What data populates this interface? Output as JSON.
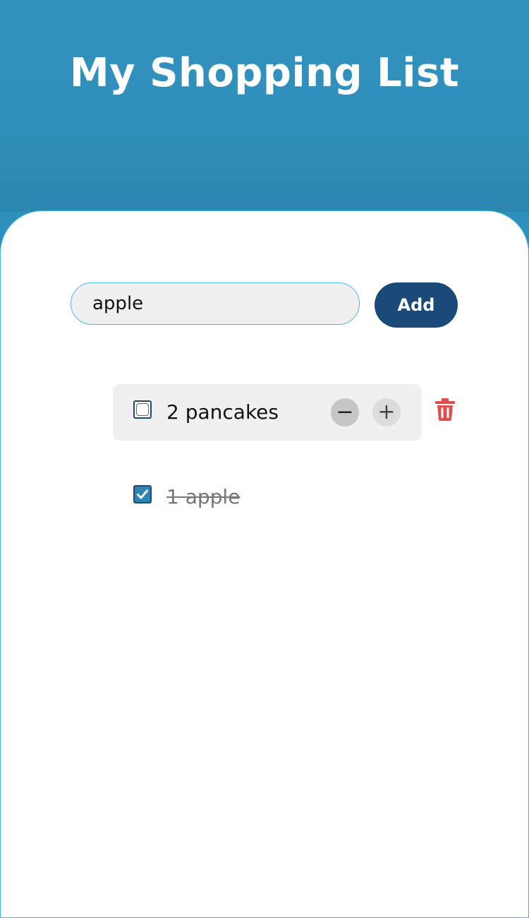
{
  "header": {
    "title": "My Shopping List"
  },
  "add_form": {
    "input_value": "apple",
    "add_label": "Add"
  },
  "items": [
    {
      "text": "2 pancakes",
      "checked": false
    },
    {
      "text": "1 apple",
      "checked": true
    }
  ],
  "icons": {
    "minus": "minus-icon",
    "plus": "plus-icon",
    "delete": "trash-icon",
    "check": "checkmark-icon"
  },
  "colors": {
    "header_bg": "#3190bb",
    "accent": "#194a78",
    "danger": "#e04e4e",
    "input_border": "#4fb7e8"
  }
}
